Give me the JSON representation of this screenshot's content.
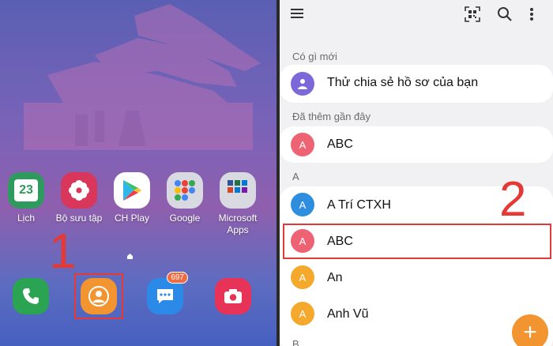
{
  "home": {
    "apps": [
      {
        "label": "Lịch",
        "icon": "calendar-icon",
        "date": "23"
      },
      {
        "label": "Bộ sưu tập",
        "icon": "gallery-flower-icon"
      },
      {
        "label": "CH Play",
        "icon": "play-store-icon"
      },
      {
        "label": "Google",
        "icon": "google-folder-icon"
      },
      {
        "label": "Microsoft Apps",
        "icon": "microsoft-folder-icon"
      }
    ],
    "dock": [
      {
        "icon": "phone-icon"
      },
      {
        "icon": "contacts-icon"
      },
      {
        "icon": "messages-icon",
        "badge": "697"
      },
      {
        "icon": "camera-icon"
      }
    ],
    "step_number": "1"
  },
  "contacts": {
    "step_number": "2",
    "toolbar": {
      "menu_icon": "hamburger-menu-icon",
      "qr_icon": "qr-code-icon",
      "search_icon": "search-icon",
      "more_icon": "more-vertical-icon"
    },
    "whats_new": {
      "header": "Có gì mới",
      "item": "Thử chia sẻ hồ sơ của bạn"
    },
    "recent": {
      "header": "Đã thêm gần đây",
      "item": {
        "initial": "A",
        "name": "ABC"
      }
    },
    "group_a": {
      "header": "A",
      "items": [
        {
          "initial": "A",
          "name": "A Trí CTXH",
          "color": "#2f8de0"
        },
        {
          "initial": "A",
          "name": "ABC",
          "color": "#ee6373"
        },
        {
          "initial": "A",
          "name": "An",
          "color": "#f4a92d"
        },
        {
          "initial": "A",
          "name": "Anh Vũ",
          "color": "#f4a92d"
        }
      ]
    },
    "group_b_header": "B",
    "fab_label": "+"
  },
  "colors": {
    "highlight": "#e53935",
    "step_number": "#e53935"
  }
}
